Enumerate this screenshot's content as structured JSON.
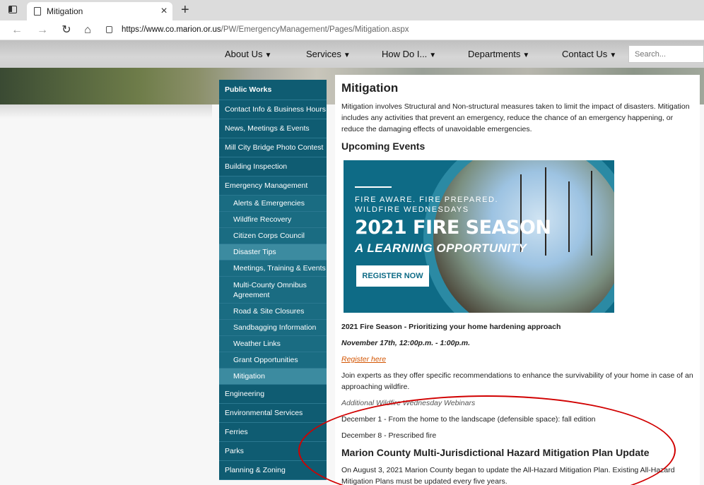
{
  "browser": {
    "tab_title": "Mitigation",
    "tab_close": "×",
    "new_tab": "+",
    "url_host": "https://www.co.marion.or.us",
    "url_path": "/PW/EmergencyManagement/Pages/Mitigation.aspx",
    "icons": [
      "back-icon",
      "forward-icon",
      "refresh-icon",
      "home-icon",
      "lock-icon"
    ]
  },
  "topnav": {
    "items": [
      "About Us",
      "Services",
      "How Do I...",
      "Departments",
      "Contact Us"
    ],
    "search_placeholder": "Search..."
  },
  "sidebar": {
    "items": [
      {
        "label": "Public Works"
      },
      {
        "label": "Contact Info & Business Hours"
      },
      {
        "label": "News, Meetings & Events"
      },
      {
        "label": "Mill City Bridge Photo Contest"
      },
      {
        "label": "Building Inspection"
      },
      {
        "label": "Emergency Management"
      },
      {
        "label": "Alerts & Emergencies"
      },
      {
        "label": "Wildfire Recovery"
      },
      {
        "label": "Citizen Corps Council"
      },
      {
        "label": "Disaster Tips"
      },
      {
        "label": "Meetings, Training & Events"
      },
      {
        "label": "Multi-County Omnibus Agreement"
      },
      {
        "label": "Road & Site Closures"
      },
      {
        "label": "Sandbagging Information"
      },
      {
        "label": "Weather Links"
      },
      {
        "label": "Grant Opportunities"
      },
      {
        "label": "Mitigation"
      },
      {
        "label": "Engineering"
      },
      {
        "label": "Environmental Services"
      },
      {
        "label": "Ferries"
      },
      {
        "label": "Parks"
      },
      {
        "label": "Planning & Zoning"
      }
    ]
  },
  "main": {
    "title": "Mitigation",
    "intro": "Mitigation involves Structural and Non-structural measures taken to limit the impact of disasters. Mitigation includes any activities that prevent an emergency, reduce the chance of an emergency happening, or reduce the damaging effects of unavoidable emergencies.",
    "upcoming_heading": "Upcoming Events",
    "promo": {
      "line1": "FIRE AWARE. FIRE PREPARED.",
      "line2": "WILDFIRE WEDNESDAYS",
      "headline": "2021 FIRE SEASON",
      "subhead": "A LEARNING OPPORTUNITY",
      "button": "REGISTER NOW"
    },
    "event_title": "2021 Fire Season - Prioritizing your home hardening approach",
    "event_time": "November 17th, 12:00p.m. - 1:00p.m.",
    "register_link": "Register here",
    "event_desc": "Join experts as they offer specific recommendations to enhance the survivability of your home in case of an approaching wildfire.",
    "additional": "Additional Wildfire Wednesday Webinars",
    "dec1": "December 1 - From the home to the landscape (defensible space): fall edition",
    "dec8": "December 8 - Prescribed fire",
    "plan_heading": "Marion County Multi-Jurisdictional Hazard Mitigation Plan Update",
    "plan_text": "On August 3, 2021 Marion County began to update the All-Hazard Mitigation Plan. Existing All-Hazard Mitigation Plans must be updated every five years."
  }
}
